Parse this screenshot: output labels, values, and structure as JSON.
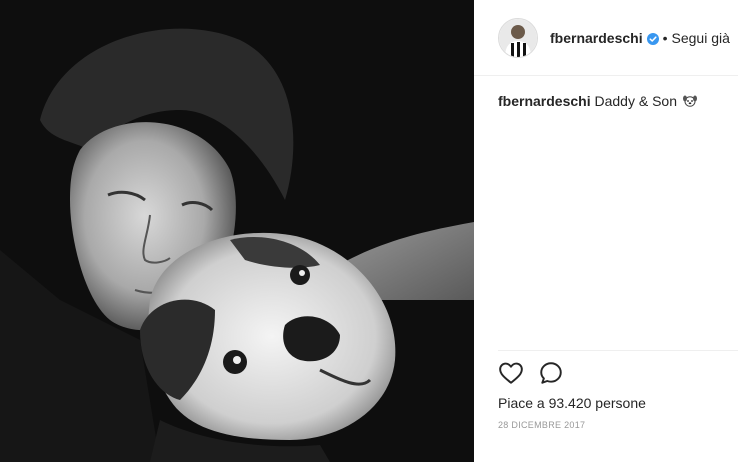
{
  "post": {
    "username": "fbernardeschi",
    "follow_status": "Segui già",
    "separator": "•",
    "caption_user": "fbernardeschi",
    "caption_text": "Daddy & Son",
    "likes_text": "Piace a 93.420 persone",
    "date": "28 DICEMBRE 2017"
  },
  "icons": {
    "verified": "verified-badge-icon",
    "caption_emoji": "dog-face-icon",
    "like": "heart-icon",
    "comment": "comment-bubble-icon"
  },
  "colors": {
    "verified_blue": "#3897f0",
    "text": "#262626",
    "muted": "#999999",
    "divider": "#efefef"
  }
}
